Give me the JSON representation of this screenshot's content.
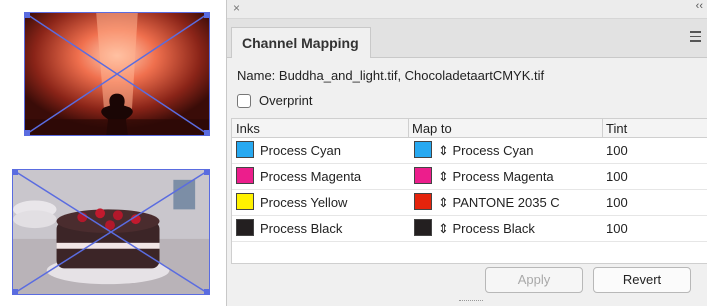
{
  "canvas": {
    "images": [
      {
        "name": "buddha-image"
      },
      {
        "name": "cake-image"
      }
    ]
  },
  "panel": {
    "close_glyph": "×",
    "collapse_glyph": "‹‹",
    "tab_title": "Channel Mapping",
    "name_line": "Name: Buddha_and_light.tif, ChocoladetaartCMYK.tif",
    "overprint_label": "Overprint",
    "overprint_checked": false,
    "columns": {
      "inks": "Inks",
      "map_to": "Map to",
      "tint": "Tint"
    },
    "rows": [
      {
        "ink": "Process Cyan",
        "ink_color": "#27a9f1",
        "map": "⇕ Process Cyan",
        "map_color": "#27a9f1",
        "tint": "100"
      },
      {
        "ink": "Process Magenta",
        "ink_color": "#ec1e8c",
        "map": "⇕ Process Magenta",
        "map_color": "#ec1e8c",
        "tint": "100"
      },
      {
        "ink": "Process Yellow",
        "ink_color": "#fff200",
        "map": "⇕ PANTONE 2035 C",
        "map_color": "#e5240c",
        "tint": "100"
      },
      {
        "ink": "Process Black",
        "ink_color": "#231f20",
        "map": "⇕ Process Black",
        "map_color": "#231f20",
        "tint": "100"
      }
    ],
    "apply_label": "Apply",
    "revert_label": "Revert"
  },
  "colors": {
    "selection": "#5a6ce0"
  }
}
